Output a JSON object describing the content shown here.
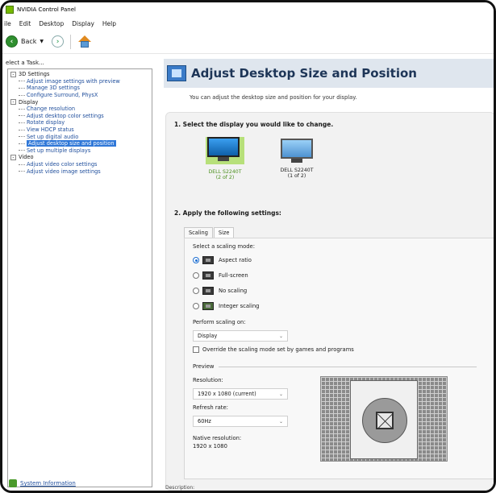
{
  "window": {
    "title": "NVIDIA Control Panel"
  },
  "menu": [
    "ile",
    "Edit",
    "Desktop",
    "Display",
    "Help"
  ],
  "toolbar": {
    "back_label": "Back"
  },
  "task": {
    "label": "elect a Task...",
    "tree": [
      {
        "label": "3D Settings",
        "children": [
          "Adjust image settings with preview",
          "Manage 3D settings",
          "Configure Surround, PhysX"
        ]
      },
      {
        "label": "Display",
        "children": [
          "Change resolution",
          "Adjust desktop color settings",
          "Rotate display",
          "View HDCP status",
          "Set up digital audio",
          "Adjust desktop size and position",
          "Set up multiple displays"
        ]
      },
      {
        "label": "Video",
        "children": [
          "Adjust video color settings",
          "Adjust video image settings"
        ]
      }
    ],
    "selected": "Adjust desktop size and position",
    "system_info": "System Information"
  },
  "page": {
    "title": "Adjust Desktop Size and Position",
    "description": "You can adjust the desktop size and position for your display.",
    "step1": "1. Select the display you would like to change.",
    "displays": [
      {
        "name": "DELL S2240T",
        "sub": "(2 of 2)",
        "selected": true
      },
      {
        "name": "DELL S2240T",
        "sub": "(1 of 2)",
        "selected": false
      }
    ],
    "step2": "2. Apply the following settings:",
    "tabs": [
      "Scaling",
      "Size"
    ],
    "scaling_mode_label": "Select a scaling mode:",
    "modes": [
      "Aspect ratio",
      "Full-screen",
      "No scaling",
      "Integer scaling"
    ],
    "selected_mode": "Aspect ratio",
    "perform_label": "Perform scaling on:",
    "perform_value": "Display",
    "override_label": "Override the scaling mode set by games and programs",
    "override_checked": false,
    "preview_label": "Preview",
    "resolution_label": "Resolution:",
    "resolution_value": "1920 x 1080 (current)",
    "refresh_label": "Refresh rate:",
    "refresh_value": "60Hz",
    "native_label": "Native resolution:",
    "native_value": "1920 x 1080",
    "footer_text": "Description:"
  },
  "colors": {
    "accent": "#76b900",
    "selection": "#3078d8",
    "header_band": "#dfe6ee"
  }
}
